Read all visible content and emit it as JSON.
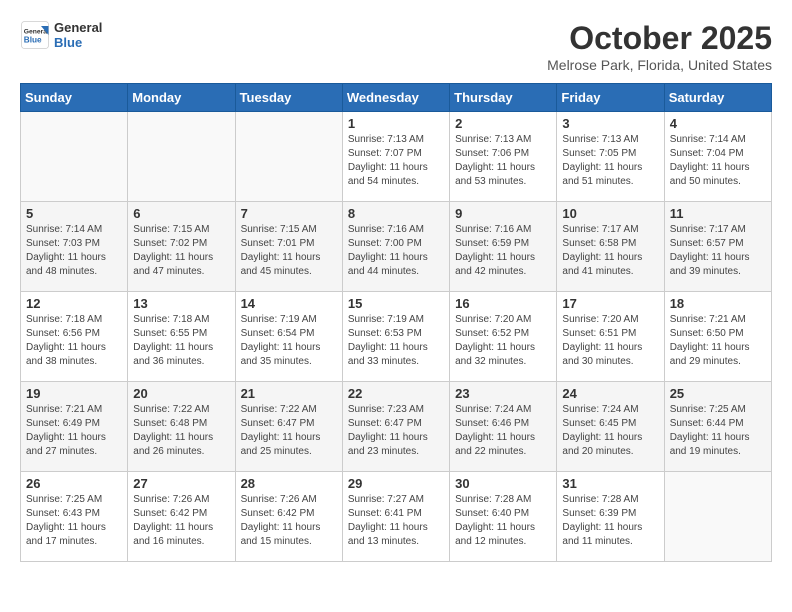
{
  "header": {
    "logo_line1": "General",
    "logo_line2": "Blue",
    "month": "October 2025",
    "location": "Melrose Park, Florida, United States"
  },
  "days_of_week": [
    "Sunday",
    "Monday",
    "Tuesday",
    "Wednesday",
    "Thursday",
    "Friday",
    "Saturday"
  ],
  "weeks": [
    [
      {
        "day": "",
        "info": ""
      },
      {
        "day": "",
        "info": ""
      },
      {
        "day": "",
        "info": ""
      },
      {
        "day": "1",
        "info": "Sunrise: 7:13 AM\nSunset: 7:07 PM\nDaylight: 11 hours\nand 54 minutes."
      },
      {
        "day": "2",
        "info": "Sunrise: 7:13 AM\nSunset: 7:06 PM\nDaylight: 11 hours\nand 53 minutes."
      },
      {
        "day": "3",
        "info": "Sunrise: 7:13 AM\nSunset: 7:05 PM\nDaylight: 11 hours\nand 51 minutes."
      },
      {
        "day": "4",
        "info": "Sunrise: 7:14 AM\nSunset: 7:04 PM\nDaylight: 11 hours\nand 50 minutes."
      }
    ],
    [
      {
        "day": "5",
        "info": "Sunrise: 7:14 AM\nSunset: 7:03 PM\nDaylight: 11 hours\nand 48 minutes."
      },
      {
        "day": "6",
        "info": "Sunrise: 7:15 AM\nSunset: 7:02 PM\nDaylight: 11 hours\nand 47 minutes."
      },
      {
        "day": "7",
        "info": "Sunrise: 7:15 AM\nSunset: 7:01 PM\nDaylight: 11 hours\nand 45 minutes."
      },
      {
        "day": "8",
        "info": "Sunrise: 7:16 AM\nSunset: 7:00 PM\nDaylight: 11 hours\nand 44 minutes."
      },
      {
        "day": "9",
        "info": "Sunrise: 7:16 AM\nSunset: 6:59 PM\nDaylight: 11 hours\nand 42 minutes."
      },
      {
        "day": "10",
        "info": "Sunrise: 7:17 AM\nSunset: 6:58 PM\nDaylight: 11 hours\nand 41 minutes."
      },
      {
        "day": "11",
        "info": "Sunrise: 7:17 AM\nSunset: 6:57 PM\nDaylight: 11 hours\nand 39 minutes."
      }
    ],
    [
      {
        "day": "12",
        "info": "Sunrise: 7:18 AM\nSunset: 6:56 PM\nDaylight: 11 hours\nand 38 minutes."
      },
      {
        "day": "13",
        "info": "Sunrise: 7:18 AM\nSunset: 6:55 PM\nDaylight: 11 hours\nand 36 minutes."
      },
      {
        "day": "14",
        "info": "Sunrise: 7:19 AM\nSunset: 6:54 PM\nDaylight: 11 hours\nand 35 minutes."
      },
      {
        "day": "15",
        "info": "Sunrise: 7:19 AM\nSunset: 6:53 PM\nDaylight: 11 hours\nand 33 minutes."
      },
      {
        "day": "16",
        "info": "Sunrise: 7:20 AM\nSunset: 6:52 PM\nDaylight: 11 hours\nand 32 minutes."
      },
      {
        "day": "17",
        "info": "Sunrise: 7:20 AM\nSunset: 6:51 PM\nDaylight: 11 hours\nand 30 minutes."
      },
      {
        "day": "18",
        "info": "Sunrise: 7:21 AM\nSunset: 6:50 PM\nDaylight: 11 hours\nand 29 minutes."
      }
    ],
    [
      {
        "day": "19",
        "info": "Sunrise: 7:21 AM\nSunset: 6:49 PM\nDaylight: 11 hours\nand 27 minutes."
      },
      {
        "day": "20",
        "info": "Sunrise: 7:22 AM\nSunset: 6:48 PM\nDaylight: 11 hours\nand 26 minutes."
      },
      {
        "day": "21",
        "info": "Sunrise: 7:22 AM\nSunset: 6:47 PM\nDaylight: 11 hours\nand 25 minutes."
      },
      {
        "day": "22",
        "info": "Sunrise: 7:23 AM\nSunset: 6:47 PM\nDaylight: 11 hours\nand 23 minutes."
      },
      {
        "day": "23",
        "info": "Sunrise: 7:24 AM\nSunset: 6:46 PM\nDaylight: 11 hours\nand 22 minutes."
      },
      {
        "day": "24",
        "info": "Sunrise: 7:24 AM\nSunset: 6:45 PM\nDaylight: 11 hours\nand 20 minutes."
      },
      {
        "day": "25",
        "info": "Sunrise: 7:25 AM\nSunset: 6:44 PM\nDaylight: 11 hours\nand 19 minutes."
      }
    ],
    [
      {
        "day": "26",
        "info": "Sunrise: 7:25 AM\nSunset: 6:43 PM\nDaylight: 11 hours\nand 17 minutes."
      },
      {
        "day": "27",
        "info": "Sunrise: 7:26 AM\nSunset: 6:42 PM\nDaylight: 11 hours\nand 16 minutes."
      },
      {
        "day": "28",
        "info": "Sunrise: 7:26 AM\nSunset: 6:42 PM\nDaylight: 11 hours\nand 15 minutes."
      },
      {
        "day": "29",
        "info": "Sunrise: 7:27 AM\nSunset: 6:41 PM\nDaylight: 11 hours\nand 13 minutes."
      },
      {
        "day": "30",
        "info": "Sunrise: 7:28 AM\nSunset: 6:40 PM\nDaylight: 11 hours\nand 12 minutes."
      },
      {
        "day": "31",
        "info": "Sunrise: 7:28 AM\nSunset: 6:39 PM\nDaylight: 11 hours\nand 11 minutes."
      },
      {
        "day": "",
        "info": ""
      }
    ]
  ]
}
